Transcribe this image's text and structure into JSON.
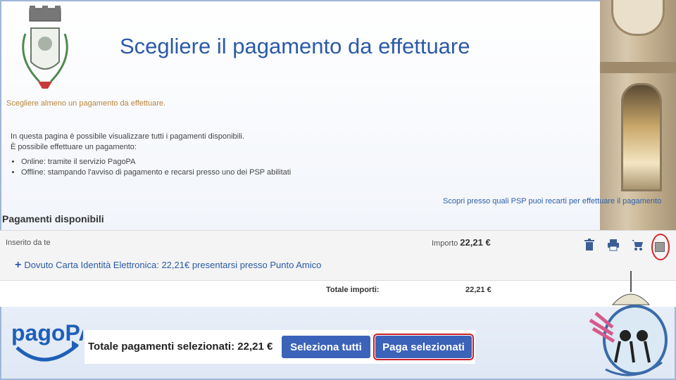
{
  "header": {
    "title": "Scegliere il pagamento da effettuare"
  },
  "notice": {
    "warning": "Scegliere almeno un pagamento da effettuare."
  },
  "info": {
    "line1": "In questa pagina è possibile visualizzare tutti i pagamenti disponibili.",
    "line2": "È possibile effettuare un pagamento:",
    "bullets": [
      "Online: tramite il servizio PagoPA",
      "Offline: stampando l'avviso di pagamento e recarsi presso uno dei PSP abilitati"
    ]
  },
  "links": {
    "psp": "Scopri presso quali PSP puoi recarti per effettuare il pagamento"
  },
  "section": {
    "title": "Pagamenti disponibili"
  },
  "table": {
    "inserito": "Inserito da te",
    "importo_label": "Importo",
    "importo_value": "22,21 €",
    "item": "Dovuto Carta Identità Elettronica: 22,21€ presentarsi presso Punto Amico",
    "totale_label": "Totale importi:",
    "totale_value": "22,21 €",
    "icons": [
      "trash-icon",
      "print-icon",
      "cart-icon",
      "checkbox"
    ]
  },
  "footer": {
    "brand": "pagoPA",
    "selected_total": "Totale pagamenti selezionati: 22,21 €",
    "select_all": "Seleziona tutti",
    "pay_selected": "Paga selezionati"
  },
  "colors": {
    "title": "#2b5aa8",
    "button": "#3b63b9",
    "highlight": "#c9202a",
    "warning": "#b8863b"
  }
}
